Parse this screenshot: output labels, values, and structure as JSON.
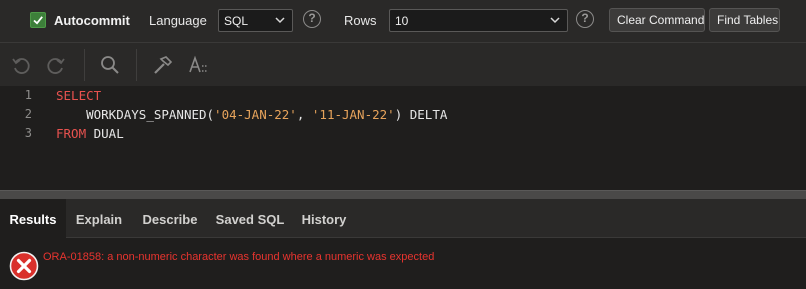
{
  "toolbar": {
    "autocommit_label": "Autocommit",
    "autocommit_checked": true,
    "language_label": "Language",
    "language_value": "SQL",
    "rows_label": "Rows",
    "rows_value": "10",
    "help_glyph": "?",
    "clear_command_label": "Clear Command",
    "find_tables_label": "Find Tables"
  },
  "editor_tools": [
    "undo-icon",
    "redo-icon",
    "search-icon",
    "hammer-icon",
    "format-text-icon"
  ],
  "editor": {
    "lines": [
      {
        "number": "1",
        "kw1": "SELECT",
        "indent": "",
        "fn": "",
        "q1": "",
        "sep": "",
        "q2": "",
        "tail": ""
      },
      {
        "number": "2",
        "kw1": "",
        "indent": "    ",
        "fn": "WORKDAYS_SPANNED(",
        "q1": "'04-JAN-22'",
        "sep": ", ",
        "q2": "'11-JAN-22'",
        "tail": ") DELTA"
      },
      {
        "number": "3",
        "kw1": "FROM",
        "indent": "",
        "fn": " DUAL",
        "q1": "",
        "sep": "",
        "q2": "",
        "tail": ""
      }
    ]
  },
  "result_tabs": [
    {
      "label": "Results",
      "active": true
    },
    {
      "label": "Explain",
      "active": false
    },
    {
      "label": "Describe",
      "active": false
    },
    {
      "label": "Saved SQL",
      "active": false
    },
    {
      "label": "History",
      "active": false
    }
  ],
  "results": {
    "error_icon": "error-x-icon",
    "error_message": "ORA-01858: a non-numeric character was found where a numeric was expected"
  },
  "colors": {
    "keyword": "#e8524f",
    "string": "#e6a35b",
    "error": "#e8342f",
    "checkbox": "#3d7f3a"
  }
}
